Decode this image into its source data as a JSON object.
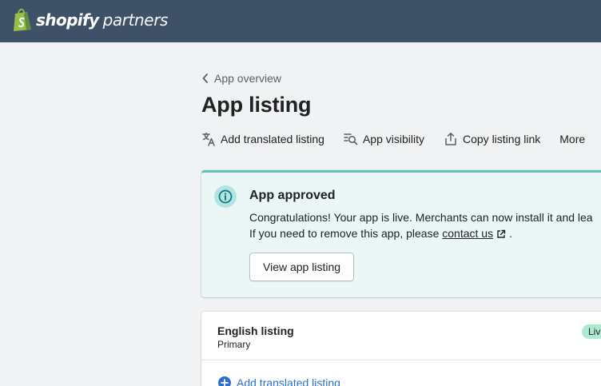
{
  "topbar": {
    "brand": "shopify",
    "product": "partners"
  },
  "breadcrumb": {
    "label": "App overview"
  },
  "page": {
    "title": "App listing"
  },
  "actions": [
    {
      "label": "Add translated listing",
      "icon": "translate-icon"
    },
    {
      "label": "App visibility",
      "icon": "visibility-search-icon"
    },
    {
      "label": "Copy listing link",
      "icon": "share-icon"
    },
    {
      "label": "More",
      "icon": ""
    }
  ],
  "banner": {
    "title": "App approved",
    "line1": "Congratulations! Your app is live. Merchants can now install it and lea",
    "line2_prefix": "If you need to remove this app, please ",
    "line2_link": "contact us",
    "line2_suffix": " .",
    "button": "View app listing",
    "accent_color": "#5ec3c1",
    "background_color": "#ebf7f7"
  },
  "listing_card": {
    "title": "English listing",
    "subtitle": "Primary",
    "badge": "Liv",
    "add_link": "Add translated listing",
    "badge_color": "#aee9d1",
    "link_color": "#2c6ecb"
  },
  "colors": {
    "topbar": "#3f5167",
    "page_background": "#f1f2f3"
  }
}
